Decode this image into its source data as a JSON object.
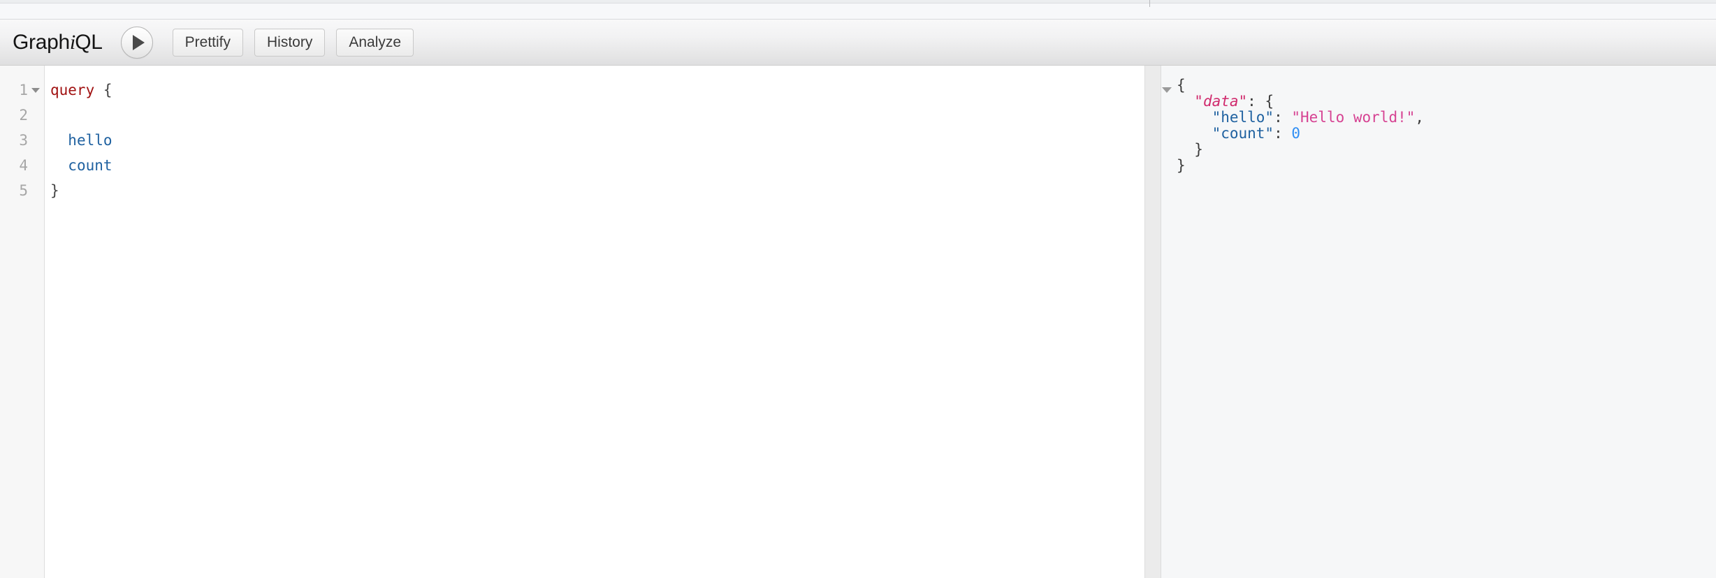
{
  "app": {
    "logo_before": "Graph",
    "logo_italic": "i",
    "logo_after": "QL"
  },
  "toolbar": {
    "execute_label": "▶",
    "execute_title": "Execute Query",
    "buttons": [
      {
        "label": "Prettify",
        "name": "prettify-button"
      },
      {
        "label": "History",
        "name": "history-button"
      },
      {
        "label": "Analyze",
        "name": "analyze-button"
      }
    ]
  },
  "editor": {
    "line_numbers": [
      "1",
      "2",
      "3",
      "4",
      "5"
    ],
    "lines": [
      {
        "tokens": [
          {
            "t": "query",
            "c": "tok-kw"
          },
          {
            "t": " ",
            "c": "tok-punct"
          },
          {
            "t": "{",
            "c": "tok-punct"
          }
        ]
      },
      {
        "tokens": [
          {
            "t": "",
            "c": "tok-punct"
          }
        ]
      },
      {
        "tokens": [
          {
            "t": "  ",
            "c": "tok-punct"
          },
          {
            "t": "hello",
            "c": "tok-field"
          }
        ]
      },
      {
        "tokens": [
          {
            "t": "  ",
            "c": "tok-punct"
          },
          {
            "t": "count",
            "c": "tok-field"
          }
        ]
      },
      {
        "tokens": [
          {
            "t": "}",
            "c": "tok-punct"
          }
        ]
      }
    ],
    "plain": "query {\n\n  hello\n  count\n}"
  },
  "result": {
    "lines": [
      {
        "tokens": [
          {
            "t": "{",
            "c": "res-brace"
          }
        ]
      },
      {
        "tokens": [
          {
            "t": "  ",
            "c": "res-punct"
          },
          {
            "t": "\"data\"",
            "c": "res-dkey"
          },
          {
            "t": ": ",
            "c": "res-punct"
          },
          {
            "t": "{",
            "c": "res-brace"
          }
        ]
      },
      {
        "tokens": [
          {
            "t": "    ",
            "c": "res-punct"
          },
          {
            "t": "\"hello\"",
            "c": "res-key"
          },
          {
            "t": ": ",
            "c": "res-punct"
          },
          {
            "t": "\"Hello world!\"",
            "c": "res-string"
          },
          {
            "t": ",",
            "c": "res-punct"
          }
        ]
      },
      {
        "tokens": [
          {
            "t": "    ",
            "c": "res-punct"
          },
          {
            "t": "\"count\"",
            "c": "res-key"
          },
          {
            "t": ": ",
            "c": "res-punct"
          },
          {
            "t": "0",
            "c": "res-number"
          }
        ]
      },
      {
        "tokens": [
          {
            "t": "  ",
            "c": "res-punct"
          },
          {
            "t": "}",
            "c": "res-brace"
          }
        ]
      },
      {
        "tokens": [
          {
            "t": "}",
            "c": "res-brace"
          }
        ]
      }
    ],
    "plain": "{\n  \"data\": {\n    \"hello\": \"Hello world!\",\n    \"count\": 0\n  }\n}",
    "data": {
      "hello": "Hello world!",
      "count": 0
    }
  },
  "colors": {
    "keyword": "#a11212",
    "field": "#1f61a0",
    "result_data_key": "#d02a6d",
    "result_key": "#1f61a0",
    "result_string": "#d64292",
    "result_number": "#2f8ef4",
    "toolbar_bg": "#ededee",
    "result_pane_bg": "#f6f7f8",
    "editor_bg": "#ffffff"
  }
}
